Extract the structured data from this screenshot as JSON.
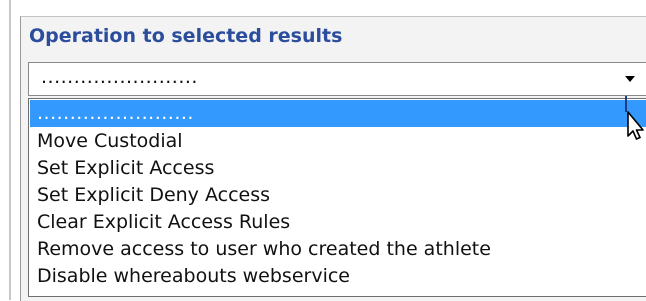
{
  "panel": {
    "title": "Operation to selected results"
  },
  "dropdown": {
    "selected_value": "........................",
    "options": [
      "........................",
      "Move Custodial",
      "Set Explicit Access",
      "Set Explicit Deny Access",
      "Clear Explicit Access Rules",
      "Remove access to user who created the athlete",
      "Disable whereabouts webservice"
    ],
    "highlighted_index": 0
  },
  "colors": {
    "title": "#2b4d9c",
    "highlight": "#3399ff"
  },
  "icons": {
    "dropdown_arrow": "chevron-down-icon",
    "cursor": "mouse-cursor-icon"
  }
}
